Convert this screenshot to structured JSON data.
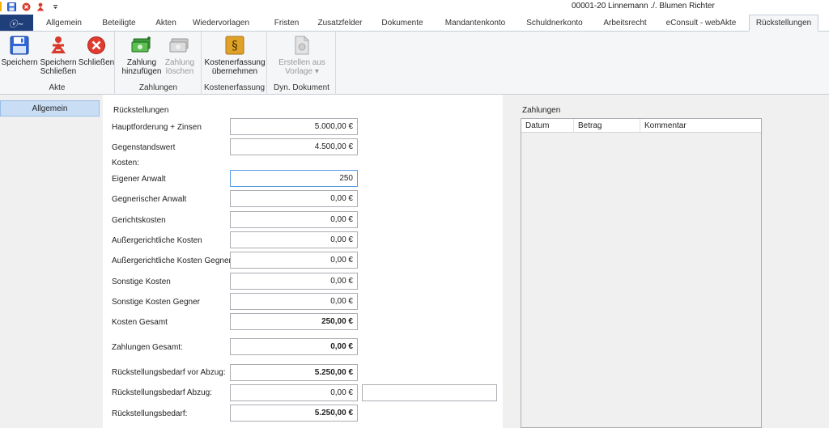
{
  "window": {
    "title": "00001-20 Linnemann ./. Blumen Richter"
  },
  "quick_access": [
    "save-icon",
    "dropdown-icon"
  ],
  "tabs": [
    {
      "label": "Allgemein"
    },
    {
      "label": "Beteiligte"
    },
    {
      "label": "Akten"
    },
    {
      "label": "Wiedervorlagen"
    },
    {
      "label": "Fristen"
    },
    {
      "label": "Zusatzfelder"
    },
    {
      "label": "Dokumente"
    },
    {
      "label": "Mandantenkonto"
    },
    {
      "label": "Schuldnerkonto"
    },
    {
      "label": "Arbeitsrecht"
    },
    {
      "label": "eConsult - webAkte"
    },
    {
      "label": "Rückstellungen"
    }
  ],
  "ribbon": {
    "akte": {
      "label": "Akte",
      "save": "Speichern",
      "save_close_line1": "Speichern",
      "save_close_line2": "Schließen",
      "close": "Schließen"
    },
    "zahlungen": {
      "label": "Zahlungen",
      "add_line1": "Zahlung",
      "add_line2": "hinzufügen",
      "del_line1": "Zahlung",
      "del_line2": "löschen"
    },
    "kostenerfassung": {
      "label": "Kostenerfassung",
      "take_line1": "Kostenerfassung",
      "take_line2": "übernehmen"
    },
    "dyn": {
      "label": "Dyn. Dokument",
      "create_line1": "Erstellen aus",
      "create_line2": "Vorlage ▾"
    }
  },
  "sidebar": {
    "items": [
      {
        "label": "Allgemein"
      }
    ]
  },
  "form": {
    "title": "Rückstellungen",
    "fields": {
      "hauptforderung": {
        "label": "Hauptforderung + Zinsen",
        "value": "5.000,00 €"
      },
      "gegenstandswert": {
        "label": "Gegenstandswert",
        "value": "4.500,00 €"
      },
      "kosten_header": "Kosten:",
      "eigener_anwalt": {
        "label": "Eigener Anwalt",
        "value": "250"
      },
      "gegnerischer_anwalt": {
        "label": "Gegnerischer Anwalt",
        "value": "0,00 €"
      },
      "gerichtskosten": {
        "label": "Gerichtskosten",
        "value": "0,00 €"
      },
      "aussergerichtliche": {
        "label": "Außergerichtliche Kosten",
        "value": "0,00 €"
      },
      "aussergerichtliche_gegner": {
        "label": "Außergerichtliche Kosten Gegner",
        "value": "0,00 €"
      },
      "sonstige": {
        "label": "Sonstige Kosten",
        "value": "0,00 €"
      },
      "sonstige_gegner": {
        "label": "Sonstige Kosten Gegner",
        "value": "0,00 €"
      },
      "kosten_gesamt": {
        "label": "Kosten Gesamt",
        "value": "250,00 €"
      },
      "zahlungen_gesamt": {
        "label": "Zahlungen Gesamt:",
        "value": "0,00 €"
      },
      "bedarf_vor_abzug": {
        "label": "Rückstellungsbedarf vor Abzug:",
        "value": "5.250,00 €"
      },
      "bedarf_abzug": {
        "label": "Rückstellungsbedarf Abzug:",
        "value": "0,00 €",
        "note": ""
      },
      "bedarf": {
        "label": "Rückstellungsbedarf:",
        "value": "5.250,00 €"
      }
    }
  },
  "payments": {
    "title": "Zahlungen",
    "columns": [
      "Datum",
      "Betrag",
      "Kommentar"
    ],
    "rows": []
  },
  "colors": {
    "accent": "#1f3f7a",
    "selected": "#c9def5",
    "focus_border": "#569de5"
  }
}
